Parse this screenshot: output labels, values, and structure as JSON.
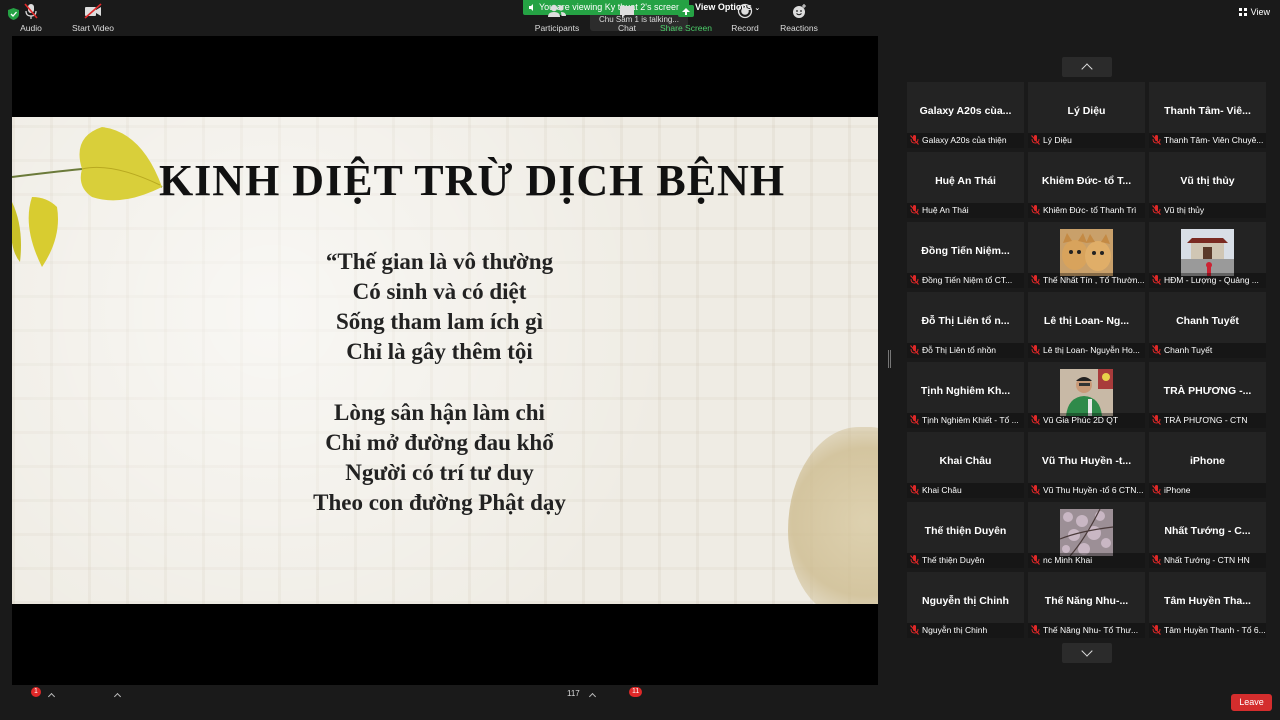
{
  "top_bar": {
    "viewing_banner": "You are viewing Ky thuat 2's screen",
    "view_options": "View Options",
    "talking_indicator": "Chu Sam 1 is talking...",
    "view_button": "View"
  },
  "slide": {
    "title": "KINH DIỆT TRỪ DỊCH BỆNH",
    "stanza1": [
      "“Thế gian là vô thường",
      "Có sinh và có diệt",
      "Sống tham lam ích gì",
      "Chỉ là gây thêm tội"
    ],
    "stanza2": [
      "Lòng sân hận làm chi",
      "Chỉ mở đường đau khổ",
      "Người có trí tư duy",
      "Theo con đường Phật dạy"
    ]
  },
  "gallery": {
    "tiles": [
      {
        "display": "Galaxy A20s cùa...",
        "caption": "Galaxy A20s của thiện"
      },
      {
        "display": "Lý Diệu",
        "caption": "Lý Diệu"
      },
      {
        "display": "Thanh Tâm- Viê...",
        "caption": "Thanh Tâm- Viên Chuyê..."
      },
      {
        "display": "Huệ An Thái",
        "caption": "Huệ An Thái"
      },
      {
        "display": "Khiêm Đức- tổ T...",
        "caption": "Khiêm Đức- tổ Thanh Trì"
      },
      {
        "display": "Vũ thị thủy",
        "caption": "Vũ thị thủy"
      },
      {
        "display": "Đồng Tiến Niệm...",
        "caption": "Đồng Tiến Niệm tổ CT..."
      },
      {
        "display": "",
        "caption": "Thế Nhất Tín , Tổ Thườn...",
        "thumb": "cats"
      },
      {
        "display": "",
        "caption": "HĐM - Lượng - Quảng ...",
        "thumb": "temple"
      },
      {
        "display": "Đỗ Thị Liên tổ n...",
        "caption": "Đỗ Thị Liên tổ nhồn"
      },
      {
        "display": "Lê thị Loan- Ng...",
        "caption": "Lê thị Loan- Nguyễn Ho..."
      },
      {
        "display": "Chanh Tuyết",
        "caption": "Chanh Tuyết"
      },
      {
        "display": "Tịnh Nghiêm Kh...",
        "caption": "Tịnh Nghiêm Khiết - Tổ ..."
      },
      {
        "display": "",
        "caption": "Vũ Gia Phúc 2D QT",
        "thumb": "man"
      },
      {
        "display": "TRÀ PHƯƠNG -...",
        "caption": "TRÀ PHƯƠNG - CTN"
      },
      {
        "display": "Khai Châu",
        "caption": "Khai Châu"
      },
      {
        "display": "Vũ Thu Huyền -t...",
        "caption": "Vũ Thu Huyền -tổ 6 CTN..."
      },
      {
        "display": "iPhone",
        "caption": "iPhone"
      },
      {
        "display": "Thế thiện Duyên",
        "caption": "Thế thiện Duyên"
      },
      {
        "display": "",
        "caption": "nc Minh Khai",
        "thumb": "blossom"
      },
      {
        "display": "Nhất Tướng - C...",
        "caption": "Nhất Tướng - CTN HN"
      },
      {
        "display": "Nguyễn thị Chinh",
        "caption": "Nguyễn thị Chinh"
      },
      {
        "display": "Thế Năng Nhu-...",
        "caption": "Thế Năng Nhu- Tổ Thư..."
      },
      {
        "display": "Tâm Huyền Tha...",
        "caption": "Tâm Huyền Thanh - Tổ 6..."
      }
    ]
  },
  "toolbar": {
    "audio": "Audio",
    "audio_badge": "1",
    "start_video": "Start Video",
    "participants": "Participants",
    "participant_count": "117",
    "chat": "Chat",
    "chat_badge": "11",
    "share_screen": "Share Screen",
    "record": "Record",
    "reactions": "Reactions",
    "leave": "Leave"
  },
  "colors": {
    "share_green": "#25a244",
    "leave_red": "#d42d2d",
    "mute_red": "#e02828",
    "background": "#1a1a1a"
  }
}
